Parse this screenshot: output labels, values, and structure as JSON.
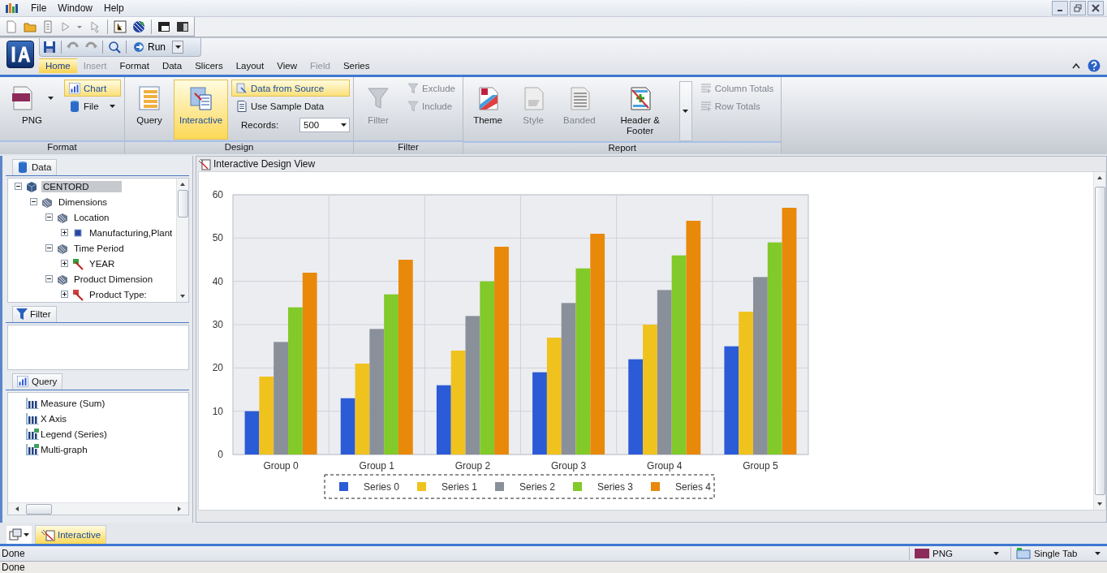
{
  "app_menu": [
    "File",
    "Window",
    "Help"
  ],
  "run_button": {
    "label": "Run"
  },
  "ribbon_tabs": [
    {
      "label": "Home",
      "selected": true,
      "disabled": false
    },
    {
      "label": "Insert",
      "selected": false,
      "disabled": true
    },
    {
      "label": "Format",
      "selected": false,
      "disabled": false
    },
    {
      "label": "Data",
      "selected": false,
      "disabled": false
    },
    {
      "label": "Slicers",
      "selected": false,
      "disabled": false
    },
    {
      "label": "Layout",
      "selected": false,
      "disabled": false
    },
    {
      "label": "View",
      "selected": false,
      "disabled": false
    },
    {
      "label": "Field",
      "selected": false,
      "disabled": true
    },
    {
      "label": "Series",
      "selected": false,
      "disabled": false
    }
  ],
  "ribbon_groups": [
    {
      "label": "Format",
      "columns": [
        {
          "items": [
            {
              "kind": "large",
              "label": "PNG",
              "dropdown": true,
              "selected": false,
              "disabled": false
            }
          ]
        },
        {
          "items": [
            {
              "kind": "small",
              "label": "Chart",
              "selected": true,
              "disabled": false
            },
            {
              "kind": "small",
              "label": "File",
              "dropdown": true,
              "selected": false,
              "disabled": false
            }
          ]
        }
      ]
    },
    {
      "label": "Design",
      "columns": [
        {
          "items": [
            {
              "kind": "large",
              "label": "Query",
              "selected": false,
              "disabled": false
            }
          ]
        },
        {
          "items": [
            {
              "kind": "large",
              "label": "Interactive",
              "selected": true,
              "disabled": false
            }
          ]
        },
        {
          "items": [
            {
              "kind": "small",
              "label": "Data from Source",
              "selected": true,
              "disabled": false
            },
            {
              "kind": "small",
              "label": "Use Sample Data",
              "selected": false,
              "disabled": false
            },
            {
              "kind": "select",
              "label": "Records:",
              "value": "500"
            }
          ]
        }
      ]
    },
    {
      "label": "Filter",
      "columns": [
        {
          "items": [
            {
              "kind": "large",
              "label": "Filter",
              "selected": false,
              "disabled": true
            }
          ]
        },
        {
          "items": [
            {
              "kind": "small",
              "label": "Exclude",
              "selected": false,
              "disabled": true
            },
            {
              "kind": "small",
              "label": "Include",
              "selected": false,
              "disabled": true
            }
          ]
        }
      ]
    },
    {
      "label": "Report",
      "columns": [
        {
          "items": [
            {
              "kind": "large",
              "label": "Theme",
              "selected": false,
              "disabled": false
            }
          ]
        },
        {
          "items": [
            {
              "kind": "large",
              "label": "Style",
              "selected": false,
              "disabled": true
            }
          ]
        },
        {
          "items": [
            {
              "kind": "large",
              "label": "Banded",
              "selected": false,
              "disabled": true
            }
          ]
        },
        {
          "items": [
            {
              "kind": "large",
              "label": "Header & Footer",
              "selected": false,
              "disabled": false
            }
          ]
        },
        {
          "items": [
            {
              "kind": "more"
            }
          ]
        },
        {
          "items": [
            {
              "kind": "small",
              "label": "Column Totals",
              "selected": false,
              "disabled": true
            },
            {
              "kind": "small",
              "label": "Row Totals",
              "selected": false,
              "disabled": true
            }
          ]
        }
      ]
    }
  ],
  "data_panel": {
    "title": "Data",
    "tree": [
      {
        "label": "CENTORD",
        "kind": "cube",
        "expanded": true,
        "selected": true,
        "children": [
          {
            "label": "Dimensions",
            "kind": "dimension",
            "expanded": true,
            "selected": false,
            "children": [
              {
                "label": "Location",
                "kind": "dimension",
                "expanded": true,
                "selected": false,
                "children": [
                  {
                    "label": "Manufacturing,Plant",
                    "kind": "level",
                    "expanded": false,
                    "selected": false
                  }
                ]
              },
              {
                "label": "Time Period",
                "kind": "dimension",
                "expanded": true,
                "selected": false,
                "children": [
                  {
                    "label": "YEAR",
                    "kind": "hierarchy-green",
                    "expanded": false,
                    "selected": false
                  }
                ]
              },
              {
                "label": "Product Dimension",
                "kind": "dimension",
                "expanded": true,
                "selected": false,
                "children": [
                  {
                    "label": "Product Type:",
                    "kind": "hierarchy-red",
                    "expanded": false,
                    "selected": false
                  }
                ]
              }
            ]
          }
        ]
      }
    ]
  },
  "filter_panel": {
    "title": "Filter"
  },
  "query_panel": {
    "title": "Query",
    "items": [
      {
        "label": "Measure (Sum)",
        "kind": "bars"
      },
      {
        "label": "X Axis",
        "kind": "bars"
      },
      {
        "label": "Legend (Series)",
        "kind": "bars-list"
      },
      {
        "label": "Multi-graph",
        "kind": "bars-list"
      }
    ]
  },
  "design_view": {
    "title": "Interactive Design View",
    "chart_data": {
      "type": "bar",
      "categories": [
        "Group 0",
        "Group 1",
        "Group 2",
        "Group 3",
        "Group 4",
        "Group 5"
      ],
      "series": [
        {
          "name": "Series 0",
          "color": "#2b5bd6",
          "values": [
            10,
            13,
            16,
            19,
            22,
            25
          ]
        },
        {
          "name": "Series 1",
          "color": "#f0c21e",
          "values": [
            18,
            21,
            24,
            27,
            30,
            33
          ]
        },
        {
          "name": "Series 2",
          "color": "#8a9099",
          "values": [
            26,
            29,
            32,
            35,
            38,
            41
          ]
        },
        {
          "name": "Series 3",
          "color": "#82c92a",
          "values": [
            34,
            37,
            40,
            43,
            46,
            49
          ]
        },
        {
          "name": "Series 4",
          "color": "#e8890a",
          "values": [
            42,
            45,
            48,
            51,
            54,
            57
          ]
        }
      ],
      "ylim": [
        0,
        60
      ],
      "yticks": [
        0,
        10,
        20,
        30,
        40,
        50,
        60
      ],
      "grid": true,
      "legend": true
    }
  },
  "view_tabs": [
    {
      "label": "Interactive",
      "selected": true
    }
  ],
  "status_bar": {
    "text": "Done",
    "output_format": "PNG",
    "tab_mode": "Single Tab"
  },
  "bottom_status": "Done"
}
